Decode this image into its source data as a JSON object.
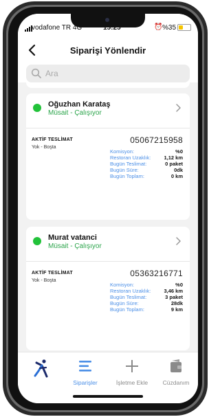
{
  "status_bar": {
    "carrier": "vodafone TR  4G",
    "time": "15:25",
    "battery_pct": "%35",
    "battery_level": 0.35,
    "battery_color": "#f5c400"
  },
  "header": {
    "title": "Siparişi Yönlendir",
    "back_icon": "chevron-left-icon"
  },
  "search": {
    "placeholder": "Ara",
    "icon": "search-icon"
  },
  "couriers": [
    {
      "name": "Oğuzhan Karataş",
      "status": "Müsait - Çalışıyor",
      "status_color": "#22c23a",
      "active_label": "AKTİF TESLİMAT",
      "active_value": "Yok - Boşta",
      "phone": "05067215958",
      "stats": [
        {
          "label": "Komisyon:",
          "value": "%0"
        },
        {
          "label": "Restoran Uzaklık:",
          "value": "1,12 km"
        },
        {
          "label": "Bugün Teslimat:",
          "value": "0 paket"
        },
        {
          "label": "Bugün Süre:",
          "value": "0dk"
        },
        {
          "label": "Bugün Toplam:",
          "value": "0 km"
        }
      ]
    },
    {
      "name": "Murat vatanci",
      "status": "Müsait - Çalışıyor",
      "status_color": "#22c23a",
      "active_label": "AKTİF TESLİMAT",
      "active_value": "Yok - Boşta",
      "phone": "05363216771",
      "stats": [
        {
          "label": "Komisyon:",
          "value": "%0"
        },
        {
          "label": "Restoran Uzaklık:",
          "value": "3,46 km"
        },
        {
          "label": "Bugün Teslimat:",
          "value": "3 paket"
        },
        {
          "label": "Bugün Süre:",
          "value": "28dk"
        },
        {
          "label": "Bugün Toplam:",
          "value": "9 km"
        }
      ]
    }
  ],
  "bottom_nav": {
    "items": [
      {
        "label": "",
        "icon": "runner-logo-icon",
        "active": false
      },
      {
        "label": "Siparişler",
        "icon": "list-icon",
        "active": true
      },
      {
        "label": "İşletme Ekle",
        "icon": "plus-icon",
        "active": false
      },
      {
        "label": "Cüzdanım",
        "icon": "wallet-icon",
        "active": false
      }
    ],
    "active_color": "#4a8ee6"
  }
}
